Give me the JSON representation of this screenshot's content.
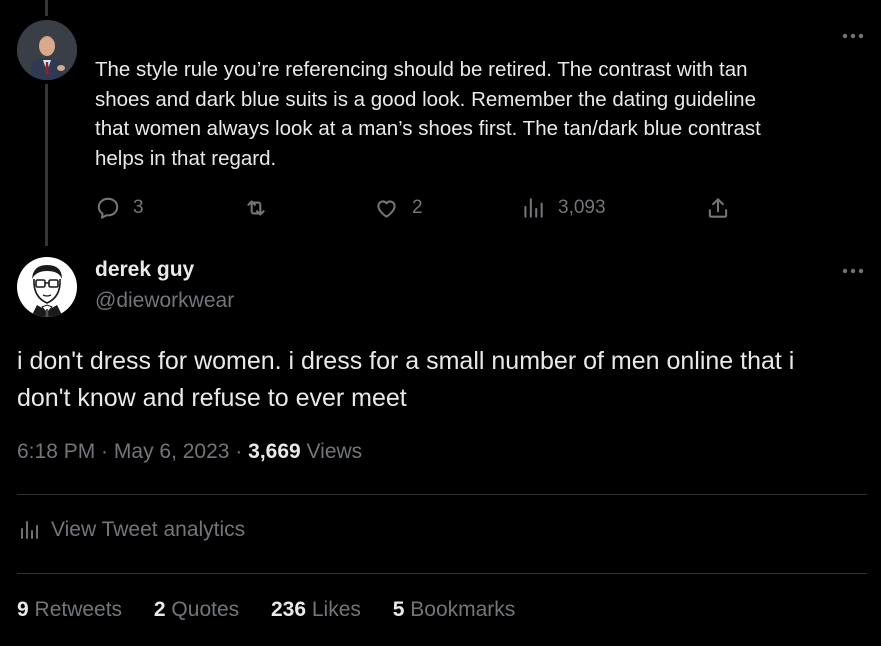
{
  "reply_tweet": {
    "text": "The style rule you’re referencing should be retired. The contrast with tan\nshoes and dark blue suits is a good look. Remember the dating guideline\nthat women always look at a man’s shoes first. The tan/dark blue contrast\nhelps in that regard.",
    "actions": {
      "replies": "3",
      "retweets": "",
      "likes": "2",
      "views": "3,093"
    },
    "icons": {
      "reply": "reply-bubble-icon",
      "retweet": "retweet-icon",
      "like": "heart-icon",
      "views": "bar-chart-icon",
      "share": "share-icon",
      "more": "more-dots-icon"
    }
  },
  "main_tweet": {
    "author": {
      "display_name": "derek guy",
      "handle": "@dieworkwear"
    },
    "text": "i don't dress for women. i dress for a small number of men online that i\ndon't know and refuse to ever meet",
    "time": "6:18 PM",
    "sep1": " · ",
    "date": "May 6, 2023",
    "sep2": " · ",
    "views_count": "3,669",
    "views_label": " Views",
    "analytics_label": "View Tweet analytics",
    "stats": {
      "retweets_count": "9",
      "retweets_label": " Retweets",
      "quotes_count": "2",
      "quotes_label": " Quotes",
      "likes_count": "236",
      "likes_label": " Likes",
      "bookmarks_count": "5",
      "bookmarks_label": " Bookmarks"
    }
  },
  "colors": {
    "background": "#000000",
    "text_primary": "#e7e9ea",
    "text_secondary": "#71767b",
    "divider": "#2f3336"
  }
}
